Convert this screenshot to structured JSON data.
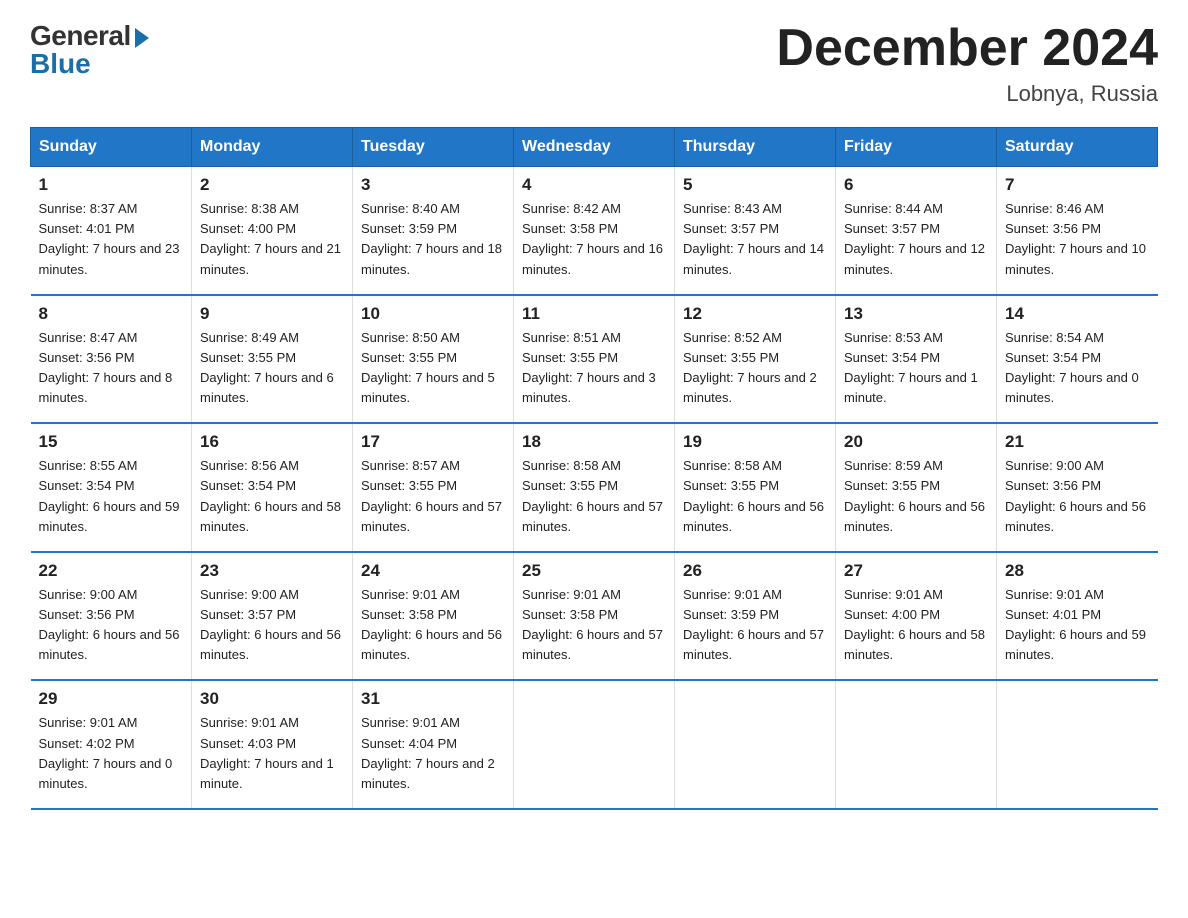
{
  "logo": {
    "general": "General",
    "blue": "Blue"
  },
  "title": "December 2024",
  "location": "Lobnya, Russia",
  "weekdays": [
    "Sunday",
    "Monday",
    "Tuesday",
    "Wednesday",
    "Thursday",
    "Friday",
    "Saturday"
  ],
  "weeks": [
    [
      {
        "day": "1",
        "sunrise": "8:37 AM",
        "sunset": "4:01 PM",
        "daylight": "7 hours and 23 minutes."
      },
      {
        "day": "2",
        "sunrise": "8:38 AM",
        "sunset": "4:00 PM",
        "daylight": "7 hours and 21 minutes."
      },
      {
        "day": "3",
        "sunrise": "8:40 AM",
        "sunset": "3:59 PM",
        "daylight": "7 hours and 18 minutes."
      },
      {
        "day": "4",
        "sunrise": "8:42 AM",
        "sunset": "3:58 PM",
        "daylight": "7 hours and 16 minutes."
      },
      {
        "day": "5",
        "sunrise": "8:43 AM",
        "sunset": "3:57 PM",
        "daylight": "7 hours and 14 minutes."
      },
      {
        "day": "6",
        "sunrise": "8:44 AM",
        "sunset": "3:57 PM",
        "daylight": "7 hours and 12 minutes."
      },
      {
        "day": "7",
        "sunrise": "8:46 AM",
        "sunset": "3:56 PM",
        "daylight": "7 hours and 10 minutes."
      }
    ],
    [
      {
        "day": "8",
        "sunrise": "8:47 AM",
        "sunset": "3:56 PM",
        "daylight": "7 hours and 8 minutes."
      },
      {
        "day": "9",
        "sunrise": "8:49 AM",
        "sunset": "3:55 PM",
        "daylight": "7 hours and 6 minutes."
      },
      {
        "day": "10",
        "sunrise": "8:50 AM",
        "sunset": "3:55 PM",
        "daylight": "7 hours and 5 minutes."
      },
      {
        "day": "11",
        "sunrise": "8:51 AM",
        "sunset": "3:55 PM",
        "daylight": "7 hours and 3 minutes."
      },
      {
        "day": "12",
        "sunrise": "8:52 AM",
        "sunset": "3:55 PM",
        "daylight": "7 hours and 2 minutes."
      },
      {
        "day": "13",
        "sunrise": "8:53 AM",
        "sunset": "3:54 PM",
        "daylight": "7 hours and 1 minute."
      },
      {
        "day": "14",
        "sunrise": "8:54 AM",
        "sunset": "3:54 PM",
        "daylight": "7 hours and 0 minutes."
      }
    ],
    [
      {
        "day": "15",
        "sunrise": "8:55 AM",
        "sunset": "3:54 PM",
        "daylight": "6 hours and 59 minutes."
      },
      {
        "day": "16",
        "sunrise": "8:56 AM",
        "sunset": "3:54 PM",
        "daylight": "6 hours and 58 minutes."
      },
      {
        "day": "17",
        "sunrise": "8:57 AM",
        "sunset": "3:55 PM",
        "daylight": "6 hours and 57 minutes."
      },
      {
        "day": "18",
        "sunrise": "8:58 AM",
        "sunset": "3:55 PM",
        "daylight": "6 hours and 57 minutes."
      },
      {
        "day": "19",
        "sunrise": "8:58 AM",
        "sunset": "3:55 PM",
        "daylight": "6 hours and 56 minutes."
      },
      {
        "day": "20",
        "sunrise": "8:59 AM",
        "sunset": "3:55 PM",
        "daylight": "6 hours and 56 minutes."
      },
      {
        "day": "21",
        "sunrise": "9:00 AM",
        "sunset": "3:56 PM",
        "daylight": "6 hours and 56 minutes."
      }
    ],
    [
      {
        "day": "22",
        "sunrise": "9:00 AM",
        "sunset": "3:56 PM",
        "daylight": "6 hours and 56 minutes."
      },
      {
        "day": "23",
        "sunrise": "9:00 AM",
        "sunset": "3:57 PM",
        "daylight": "6 hours and 56 minutes."
      },
      {
        "day": "24",
        "sunrise": "9:01 AM",
        "sunset": "3:58 PM",
        "daylight": "6 hours and 56 minutes."
      },
      {
        "day": "25",
        "sunrise": "9:01 AM",
        "sunset": "3:58 PM",
        "daylight": "6 hours and 57 minutes."
      },
      {
        "day": "26",
        "sunrise": "9:01 AM",
        "sunset": "3:59 PM",
        "daylight": "6 hours and 57 minutes."
      },
      {
        "day": "27",
        "sunrise": "9:01 AM",
        "sunset": "4:00 PM",
        "daylight": "6 hours and 58 minutes."
      },
      {
        "day": "28",
        "sunrise": "9:01 AM",
        "sunset": "4:01 PM",
        "daylight": "6 hours and 59 minutes."
      }
    ],
    [
      {
        "day": "29",
        "sunrise": "9:01 AM",
        "sunset": "4:02 PM",
        "daylight": "7 hours and 0 minutes."
      },
      {
        "day": "30",
        "sunrise": "9:01 AM",
        "sunset": "4:03 PM",
        "daylight": "7 hours and 1 minute."
      },
      {
        "day": "31",
        "sunrise": "9:01 AM",
        "sunset": "4:04 PM",
        "daylight": "7 hours and 2 minutes."
      },
      null,
      null,
      null,
      null
    ]
  ]
}
